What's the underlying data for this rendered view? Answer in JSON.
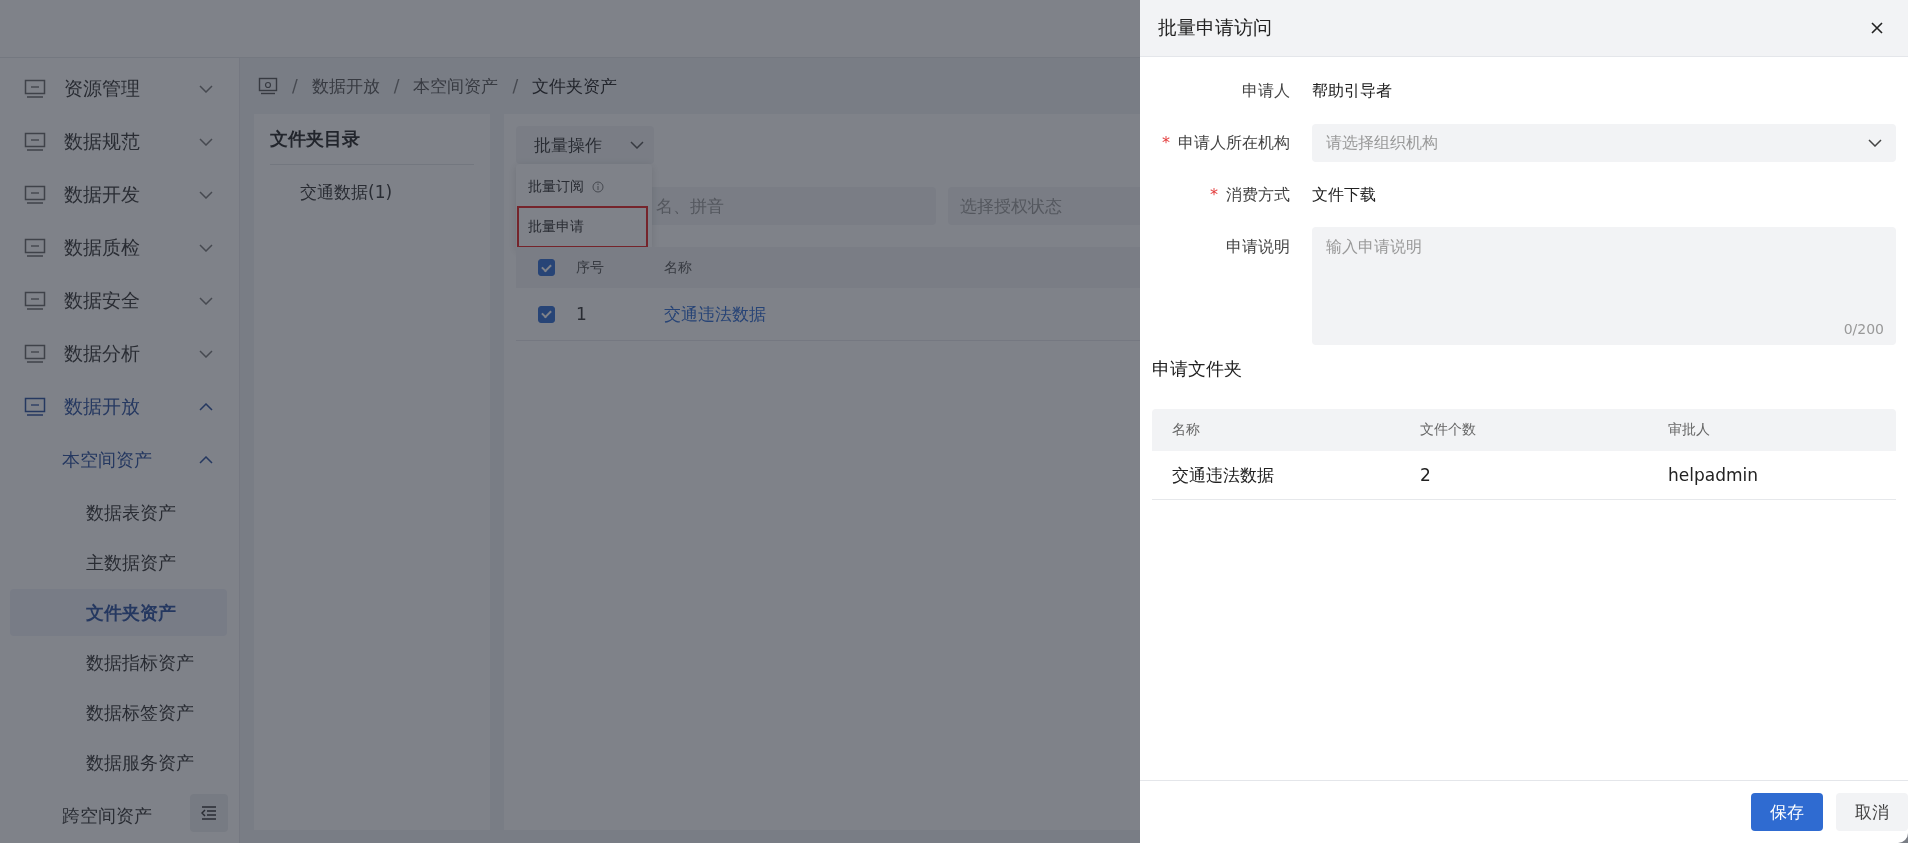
{
  "sidebar": {
    "items": [
      {
        "label": "资源管理",
        "active": false,
        "expanded": false
      },
      {
        "label": "数据规范",
        "active": false,
        "expanded": false
      },
      {
        "label": "数据开发",
        "active": false,
        "expanded": false
      },
      {
        "label": "数据质检",
        "active": false,
        "expanded": false
      },
      {
        "label": "数据安全",
        "active": false,
        "expanded": false
      },
      {
        "label": "数据分析",
        "active": false,
        "expanded": false
      },
      {
        "label": "数据开放",
        "active": true,
        "expanded": true,
        "children": [
          {
            "label": "本空间资产",
            "active": true,
            "expanded": true,
            "children": [
              {
                "label": "数据表资产",
                "selected": false
              },
              {
                "label": "主数据资产",
                "selected": false
              },
              {
                "label": "文件夹资产",
                "selected": true
              },
              {
                "label": "数据指标资产",
                "selected": false
              },
              {
                "label": "数据标签资产",
                "selected": false
              },
              {
                "label": "数据服务资产",
                "selected": false
              }
            ]
          },
          {
            "label": "跨空间资产",
            "active": false
          }
        ]
      }
    ]
  },
  "breadcrumb": {
    "separator": "/",
    "items": [
      "数据开放",
      "本空间资产",
      "文件夹资产"
    ]
  },
  "folder_panel": {
    "title": "文件夹目录",
    "items": [
      {
        "label": "交通数据(1)",
        "selected": false
      }
    ]
  },
  "toolbar": {
    "batch_button": "批量操作",
    "menu": [
      {
        "label": "批量订阅",
        "info": true,
        "highlighted": false
      },
      {
        "label": "批量申请",
        "info": false,
        "highlighted": true
      }
    ]
  },
  "filters": [
    {
      "placeholder": "名、拼音"
    },
    {
      "placeholder": "选择授权状态"
    }
  ],
  "table": {
    "header_checked": true,
    "columns": [
      "序号",
      "名称"
    ],
    "rows": [
      {
        "checked": true,
        "index": "1",
        "name": "交通违法数据"
      }
    ]
  },
  "drawer": {
    "title": "批量申请访问",
    "required_mark": "*",
    "fields": [
      {
        "kind": "text",
        "label": "申请人",
        "required": false,
        "value": "帮助引导者"
      },
      {
        "kind": "select",
        "label": "申请人所在机构",
        "required": true,
        "placeholder": "请选择组织机构"
      },
      {
        "kind": "text",
        "label": "消费方式",
        "required": true,
        "value": "文件下载"
      },
      {
        "kind": "textarea",
        "label": "申请说明",
        "required": false,
        "placeholder": "输入申请说明",
        "counter": "0/200"
      }
    ],
    "section_title": "申请文件夹",
    "table": {
      "columns": [
        "名称",
        "文件个数",
        "审批人"
      ],
      "rows": [
        [
          "交通违法数据",
          "2",
          "helpadmin"
        ]
      ]
    },
    "buttons": [
      {
        "label": "保存",
        "kind": "primary"
      },
      {
        "label": "取消",
        "kind": "default"
      }
    ]
  }
}
